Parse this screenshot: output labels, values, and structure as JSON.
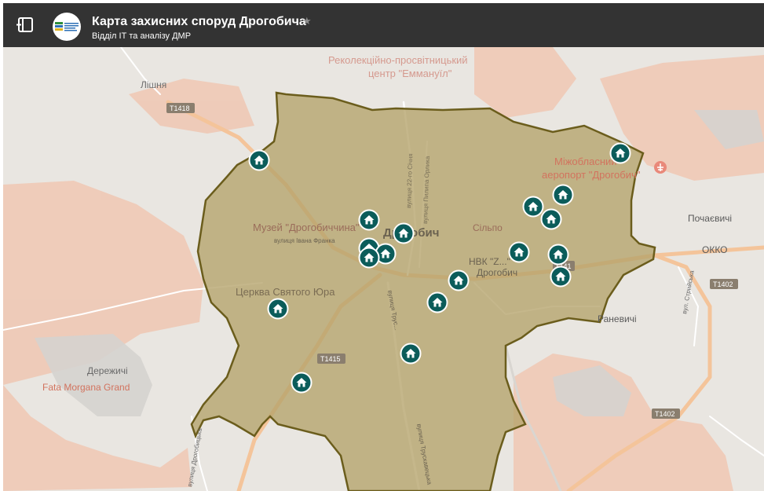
{
  "header": {
    "title": "Карта захисних споруд Дрогобича",
    "subtitle": "Відділ ІТ та аналізу ДМР",
    "star": "★"
  },
  "colors": {
    "header_bg": "#333333",
    "city_area_fill": "#b5a36a",
    "city_area_border": "#6b5d1c",
    "marker": "#0b5c5a",
    "map_bg": "#e9e6e1",
    "road": "#f4c49a"
  },
  "map": {
    "labels": {
      "reholection_1": "Реколекційно-просвітницький",
      "reholection_2": "центр \"Еммануїл\"",
      "lishnia": "Лішня",
      "t1418": "T1418",
      "city": "Дрогобич",
      "museum": "Музей \"Дрогобиччина\"",
      "street_franka": "вулиця Івана Франка",
      "church": "Церква Святого Юра",
      "silpo": "Сільпо",
      "nvk": "НВК \"Z...\"",
      "drohobych_small": "Дрогобич",
      "airport_1": "Міжобласний",
      "airport_2": "аеропорт \"Дрогобич\"",
      "pochaievychi": "Почаєвичі",
      "okko": "ОККО",
      "t1402_a": "T1402",
      "t1402_b": "T1402",
      "t1415": "T1415",
      "t1410": "T141",
      "ranevychi": "Раневичі",
      "derezhychi": "Дережичі",
      "fata_morgana": "Fata Morgana Grand",
      "street_drohobytska": "вулиця Дрогобицька",
      "street_truskavetska": "вулиця Трускавецька",
      "street_stryiska": "вул. Стрийська",
      "street_22": "вулиця 22-го Січня",
      "street_orlyka": "вулиця Пилипа Орлика",
      "street_trusk2": "вулиця Трус..."
    },
    "shelter_count": 20
  }
}
